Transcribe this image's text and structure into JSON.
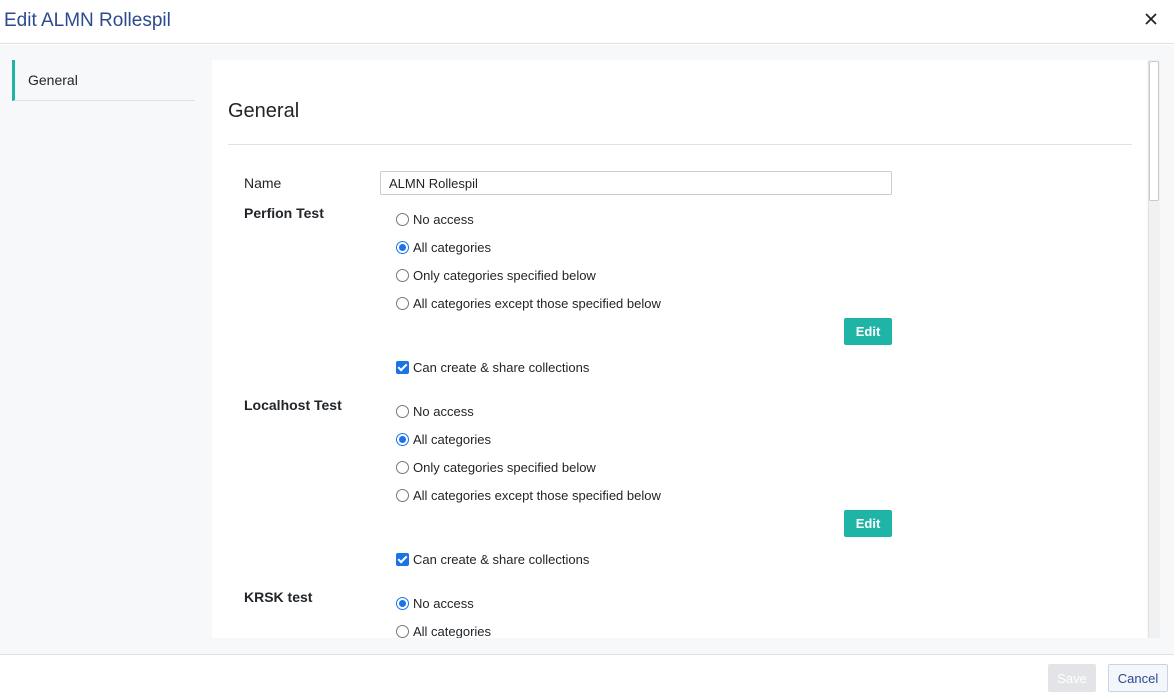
{
  "dialog": {
    "title": "Edit ALMN Rollespil",
    "close_icon": "close-icon"
  },
  "sidenav": {
    "items": [
      {
        "label": "General",
        "active": true
      }
    ]
  },
  "panel": {
    "title": "General",
    "name_label": "Name",
    "name_value": "ALMN Rollespil",
    "sections": [
      {
        "label": "Perfion Test",
        "options": [
          "No access",
          "All categories",
          "Only categories specified below",
          "All categories except those specified below"
        ],
        "selected": 1,
        "edit_label": "Edit",
        "collections_label": "Can create & share collections",
        "collections_checked": true
      },
      {
        "label": "Localhost Test",
        "options": [
          "No access",
          "All categories",
          "Only categories specified below",
          "All categories except those specified below"
        ],
        "selected": 1,
        "edit_label": "Edit",
        "collections_label": "Can create & share collections",
        "collections_checked": true
      },
      {
        "label": "KRSK test",
        "options": [
          "No access",
          "All categories"
        ],
        "selected": 0
      }
    ]
  },
  "footer": {
    "save_label": "Save",
    "cancel_label": "Cancel"
  },
  "colors": {
    "accent": "#1fb5a6",
    "title": "#2c4a8f",
    "radio": "#1a73e8"
  }
}
